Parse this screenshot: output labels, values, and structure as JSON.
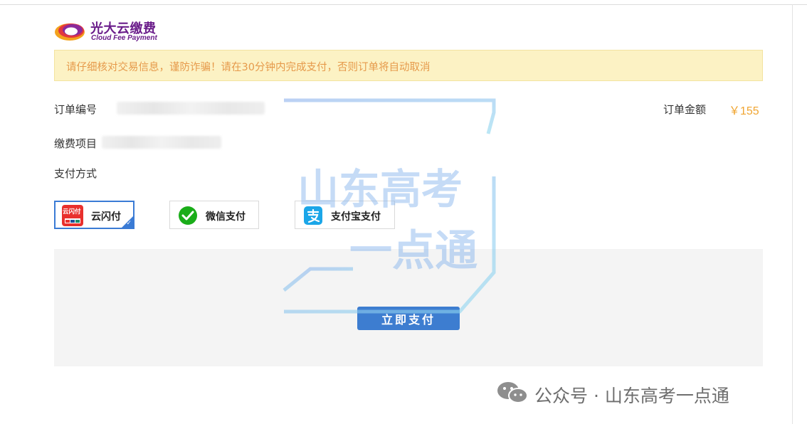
{
  "brand": {
    "name_cn": "光大云缴费",
    "name_en": "Cloud Fee Payment"
  },
  "notice": "请仔细核对交易信息，谨防诈骗！请在30分钟内完成支付，否则订单将自动取消",
  "order": {
    "number_label": "订单编号",
    "item_label": "缴费项目",
    "method_label": "支付方式",
    "amount_label": "订单金额",
    "amount_value": "￥155"
  },
  "payment_methods": [
    {
      "label": "云闪付",
      "icon_text": "云闪付",
      "icon": "unionpay-quickpass-icon",
      "selected": true
    },
    {
      "label": "微信支付",
      "icon": "wechat-pay-icon",
      "selected": false
    },
    {
      "label": "支付宝支付",
      "icon": "alipay-icon",
      "selected": false
    }
  ],
  "pay_button": "立即支付",
  "watermark": {
    "line1": "山东高考",
    "line2": "一点通"
  },
  "footer": "公众号 · 山东高考一点通",
  "colors": {
    "accent": "#3d7dd0",
    "amount": "#f0a531",
    "notice_bg": "#fcf2c4",
    "notice_text": "#e69a4b",
    "brand": "#6a1c8a"
  }
}
